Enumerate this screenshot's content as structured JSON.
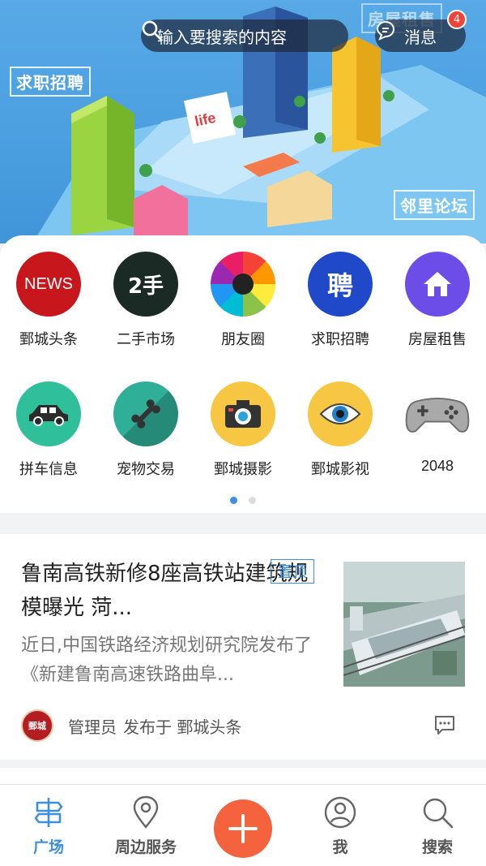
{
  "header": {
    "search_placeholder": "输入要搜索的内容",
    "messages_label": "消息",
    "messages_badge": "4"
  },
  "banner": {
    "signs": [
      "求职招聘",
      "房屋租售",
      "邻里论坛"
    ],
    "billboard_text": "life"
  },
  "grid": {
    "items": [
      {
        "label": "鄄城头条",
        "icon": "news-icon",
        "text": "NEWS",
        "color": "#c8161d"
      },
      {
        "label": "二手市场",
        "icon": "second-hand-icon",
        "text": "2手",
        "color": "#1b2a25"
      },
      {
        "label": "朋友圈",
        "icon": "aperture-icon",
        "color": "#f7b526"
      },
      {
        "label": "求职招聘",
        "icon": "recruit-icon",
        "text": "聘",
        "color": "#1f49c8"
      },
      {
        "label": "房屋租售",
        "icon": "house-icon",
        "color": "#6c4de8"
      },
      {
        "label": "拼车信息",
        "icon": "car-icon",
        "color": "#2fbf9a"
      },
      {
        "label": "宠物交易",
        "icon": "bone-icon",
        "color": "#2f9c8a"
      },
      {
        "label": "鄄城摄影",
        "icon": "camera-icon",
        "color": "#f7c743"
      },
      {
        "label": "鄄城影视",
        "icon": "eye-icon",
        "color": "#f7c743"
      },
      {
        "label": "2048",
        "icon": "gamepad-icon",
        "color": "#9a9a9a"
      }
    ],
    "page_dots": 2,
    "active_dot": 0
  },
  "news": {
    "title": "鲁南高铁新修8座高铁站建筑规模曝光 菏...",
    "tag": "置顶",
    "summary": "近日,中国铁路经济规划研究院发布了《新建鲁南高速铁路曲阜...",
    "avatar_text": "鄄城",
    "author": "管理员",
    "published_in": "发布于 鄄城头条"
  },
  "nav": {
    "items": [
      {
        "label": "广场",
        "icon": "plaza-icon",
        "active": true
      },
      {
        "label": "周边服务",
        "icon": "location-pin-icon",
        "active": false
      },
      {
        "label": "我",
        "icon": "user-icon",
        "active": false
      },
      {
        "label": "搜索",
        "icon": "search-icon",
        "active": false
      }
    ],
    "add_icon": "plus-icon"
  },
  "colors": {
    "accent": "#3d8fe0",
    "add_button": "#f4623e",
    "badge": "#f0433a"
  }
}
